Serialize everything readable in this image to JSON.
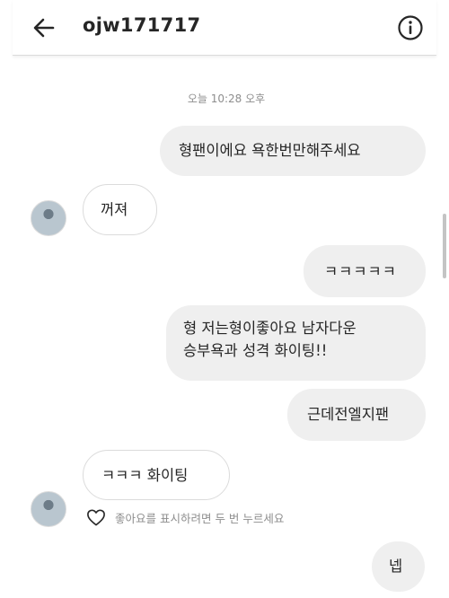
{
  "header": {
    "username": "ojw171717",
    "back_icon": "arrow-left-icon",
    "info_icon": "info-icon"
  },
  "thread": {
    "timestamp": "오늘 10:28 오후",
    "messages": [
      {
        "from": "me",
        "text": "형팬이에요 욕한번만해주세요"
      },
      {
        "from": "them",
        "text": "꺼져"
      },
      {
        "from": "me",
        "text": "ㅋㅋㅋㅋㅋ"
      },
      {
        "from": "me",
        "lines": [
          "형 저는형이좋아요 남자다운",
          "승부욕과 성격 화이팅!!"
        ]
      },
      {
        "from": "me",
        "text": "근데전엘지팬"
      },
      {
        "from": "them",
        "text": "ㅋㅋㅋ 화이팅"
      },
      {
        "from": "me",
        "text": "넵"
      }
    ],
    "like_hint": "좋아요를 표시하려면 두 번 누르세요",
    "like_icon": "heart-outline-icon"
  },
  "colors": {
    "sent_bubble": "#efefef",
    "received_border": "#dbdbdb",
    "text": "#262626",
    "muted": "#8e8e8e"
  }
}
